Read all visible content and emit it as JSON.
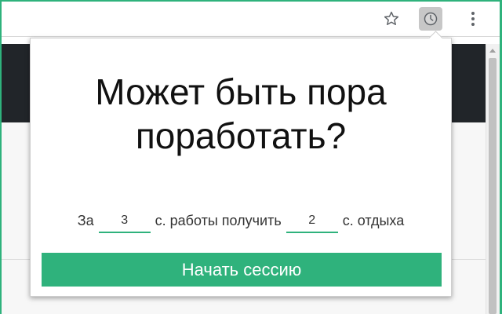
{
  "colors": {
    "accent": "#2fb27c",
    "page_header": "#212529",
    "text": "#111111"
  },
  "toolbar": {
    "icons": [
      "star-icon",
      "extension-clock-icon",
      "more-vert-icon"
    ]
  },
  "popup": {
    "title": "Может быть пора поработать?",
    "session": {
      "prefix": "За",
      "work_value": "3",
      "middle": "с. работы получить",
      "rest_value": "2",
      "suffix": "с. отдыха"
    },
    "start_button": "Начать сессию"
  }
}
